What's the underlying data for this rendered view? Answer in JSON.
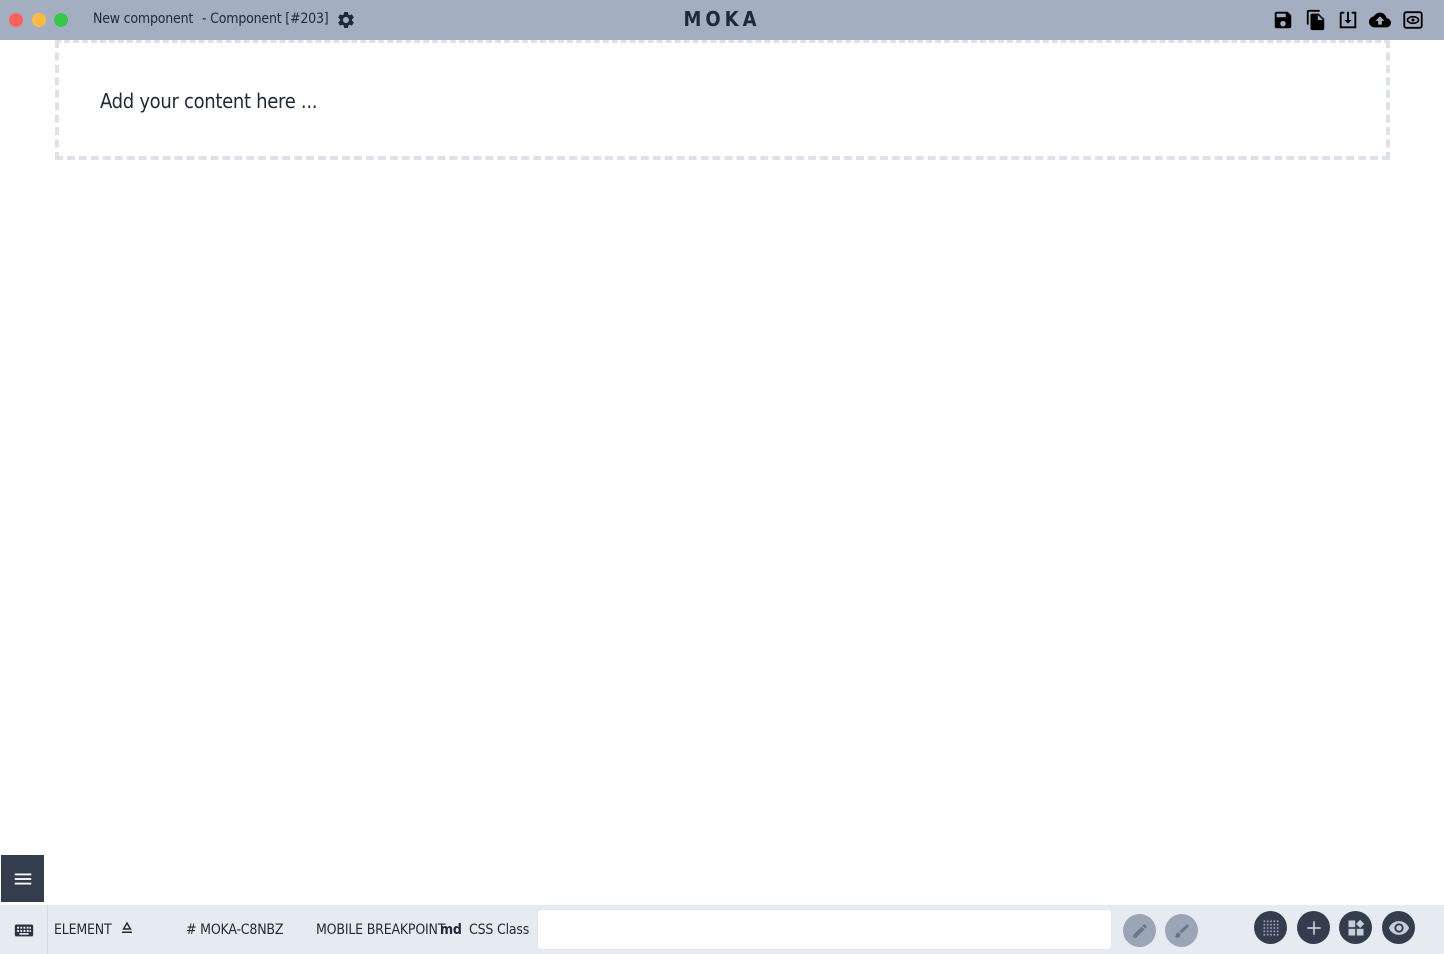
{
  "titlebar": {
    "component_name": "New component",
    "component_subtitle": "- Component [#203]",
    "brand": "MOKA",
    "icons": [
      "save-icon",
      "copy-icon",
      "download-icon",
      "cloud-upload-icon",
      "preview-icon"
    ]
  },
  "canvas": {
    "placeholder": "Add your content here ..."
  },
  "bottombar": {
    "element_label": "ELEMENT",
    "element_id": "# MOKA-C8NBZ",
    "breakpoint_label": "MOBILE BREAKPOINT",
    "breakpoint_value": "md",
    "css_class_label": "CSS Class",
    "css_class_value": ""
  },
  "colors": {
    "topbar": "#a3afc1",
    "bottombar": "#e6ebf2",
    "dark_button": "#333d4e",
    "light_button": "#9aa6b7",
    "dash_border": "#dde2ea"
  }
}
